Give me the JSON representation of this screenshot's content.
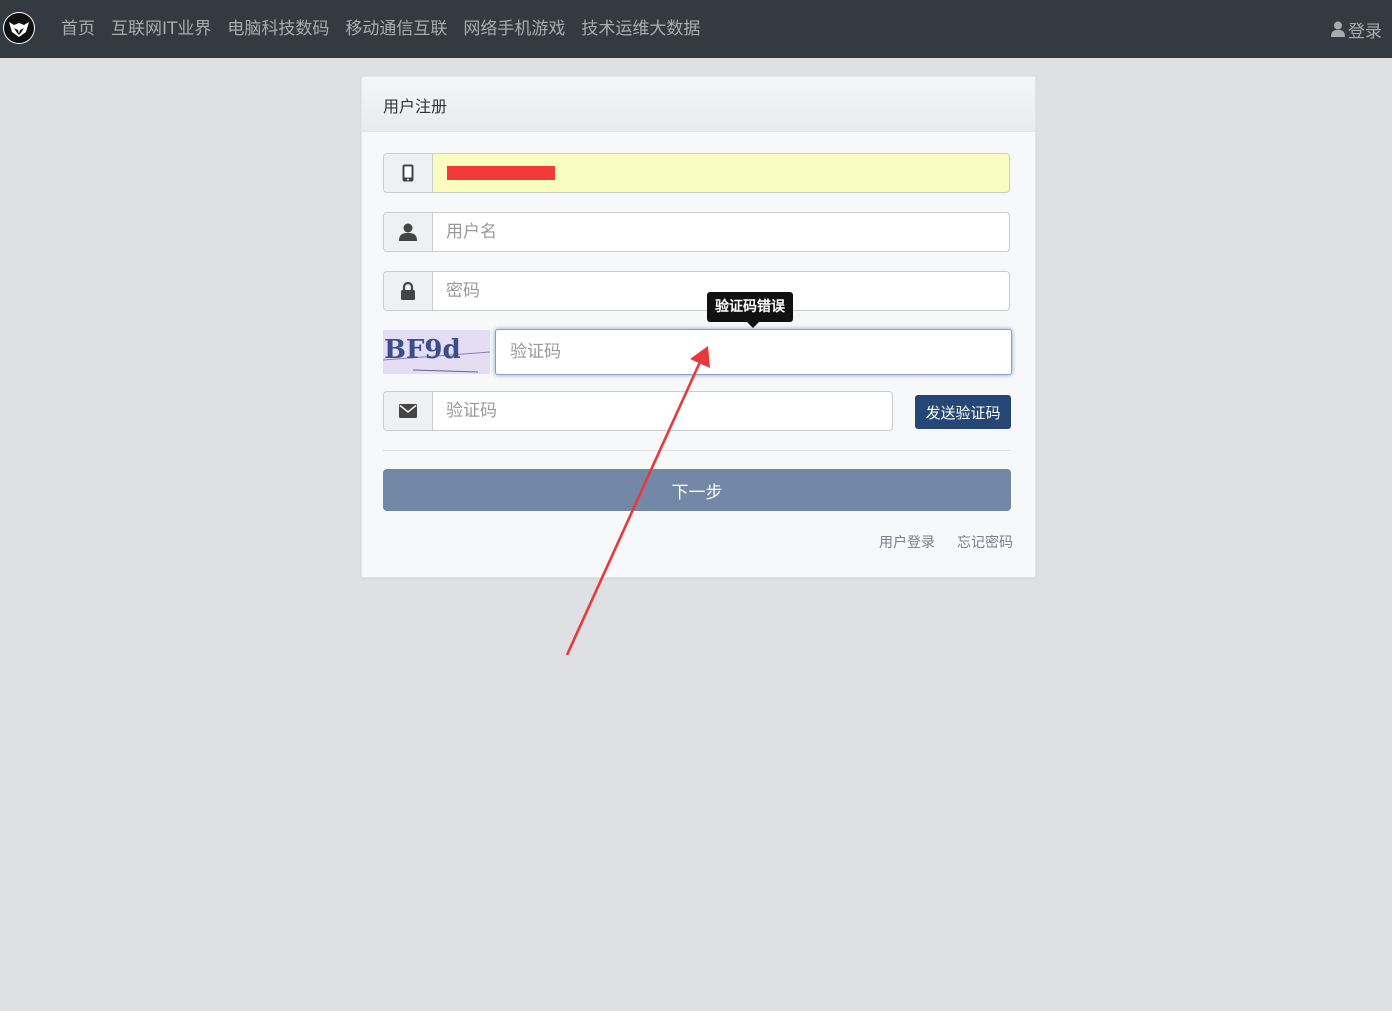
{
  "nav": {
    "items": [
      "首页",
      "互联网IT业界",
      "电脑科技数码",
      "移动通信互联",
      "网络手机游戏",
      "技术运维大数据"
    ],
    "login_label": "登录"
  },
  "panel": {
    "title": "用户注册",
    "username_placeholder": "用户名",
    "password_placeholder": "密码",
    "captcha_placeholder": "验证码",
    "captcha_image_text": "BF9d",
    "captcha_error": "验证码错误",
    "sms_placeholder": "验证码",
    "send_code_label": "发送验证码",
    "next_label": "下一步",
    "login_link": "用户登录",
    "forgot_link": "忘记密码"
  },
  "colors": {
    "navbar": "#353a42",
    "accent_button": "#264775",
    "next_button": "#7288a6",
    "autofill_bg": "#fafdc0",
    "annotation_arrow": "#e8393a"
  }
}
